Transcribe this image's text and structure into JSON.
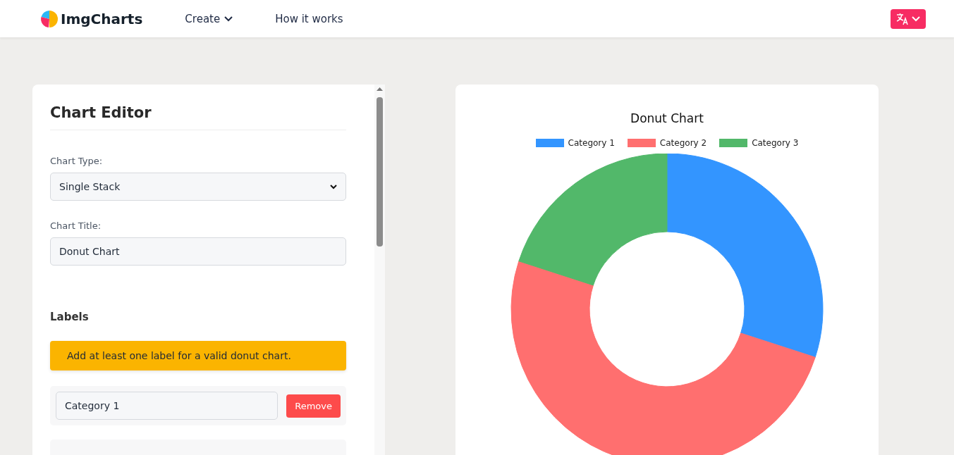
{
  "header": {
    "logo": "ImgCharts",
    "nav": [
      {
        "label": "Create",
        "kind": "dropdown"
      },
      {
        "label": "How it works",
        "kind": "link"
      }
    ]
  },
  "editor": {
    "title": "Chart Editor",
    "fields": [
      {
        "label": "Chart Type:",
        "kind": "select",
        "value": "Single Stack"
      },
      {
        "label": "Chart Title:",
        "kind": "text",
        "value": "Donut Chart"
      }
    ],
    "labels_heading": "Labels",
    "warning": "Add at least one label for a valid donut chart.",
    "label_rows": [
      {
        "value": "Category 1",
        "button": "Remove"
      }
    ]
  },
  "preview": {
    "slices": [
      {
        "color": "#3395ff"
      },
      {
        "color": "#ff6f6f"
      },
      {
        "color": "#52b86a"
      }
    ],
    "chart_data": {
      "type": "donut",
      "title": "Donut Chart",
      "categories": [
        "Category 1",
        "Category 2",
        "Category 3"
      ],
      "values": [
        30,
        50,
        20
      ]
    }
  }
}
